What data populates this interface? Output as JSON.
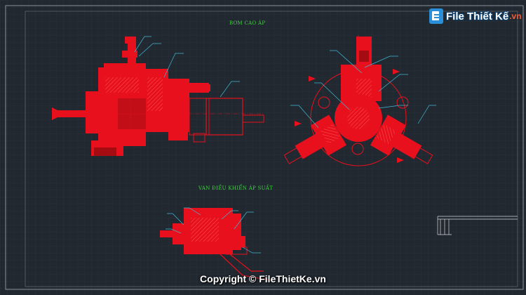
{
  "drawing": {
    "title_pump": "BƠM CAO ÁP",
    "title_valve": "VAN ĐIỀU KHIỂN ÁP SUẤT"
  },
  "watermark": {
    "brand": "File Thiết Kế",
    "domain": ".vn",
    "copyright": "Copyright © FileThietKe.vn"
  },
  "colors": {
    "background": "#212830",
    "part": "#e8101c",
    "leader": "#3fb9d6",
    "title": "#3fd23f"
  },
  "icons": [
    "file-document-icon"
  ]
}
